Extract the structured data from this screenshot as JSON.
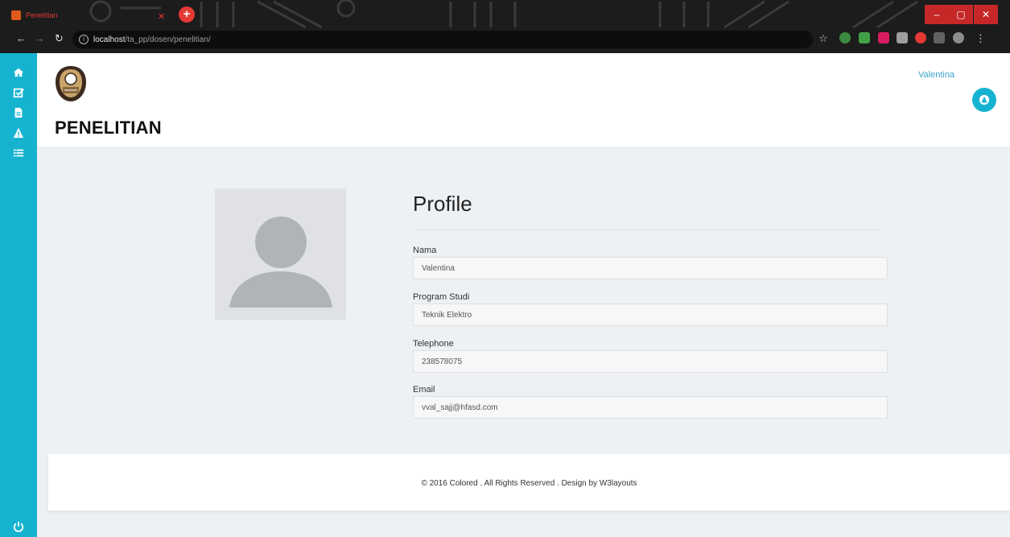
{
  "browser": {
    "tab_title": "Penelitian",
    "new_tab_label": "+",
    "url_host": "localhost",
    "url_path": "/ta_pp/dosen/penelitian/"
  },
  "sidebar": {
    "items": [
      {
        "icon": "home-icon"
      },
      {
        "icon": "checkbox-icon"
      },
      {
        "icon": "document-icon"
      },
      {
        "icon": "warning-icon"
      },
      {
        "icon": "list-icon"
      }
    ],
    "bottom_icon": "power-icon"
  },
  "header": {
    "page_title": "PENELITIAN",
    "user_name": "Valentina"
  },
  "profile": {
    "title": "Profile",
    "fields": [
      {
        "label": "Nama",
        "value": "Valentina"
      },
      {
        "label": "Program Studi",
        "value": "Teknik Elektro"
      },
      {
        "label": "Telephone",
        "value": "238578075"
      },
      {
        "label": "Email",
        "value": "vval_sajj@hfasd.com"
      }
    ]
  },
  "footer": {
    "text": "© 2016 Colored . All Rights Reserved . Design by ",
    "link": "W3layouts"
  },
  "colors": {
    "accent": "#16b3d1",
    "user_name": "#3aa6c9"
  }
}
